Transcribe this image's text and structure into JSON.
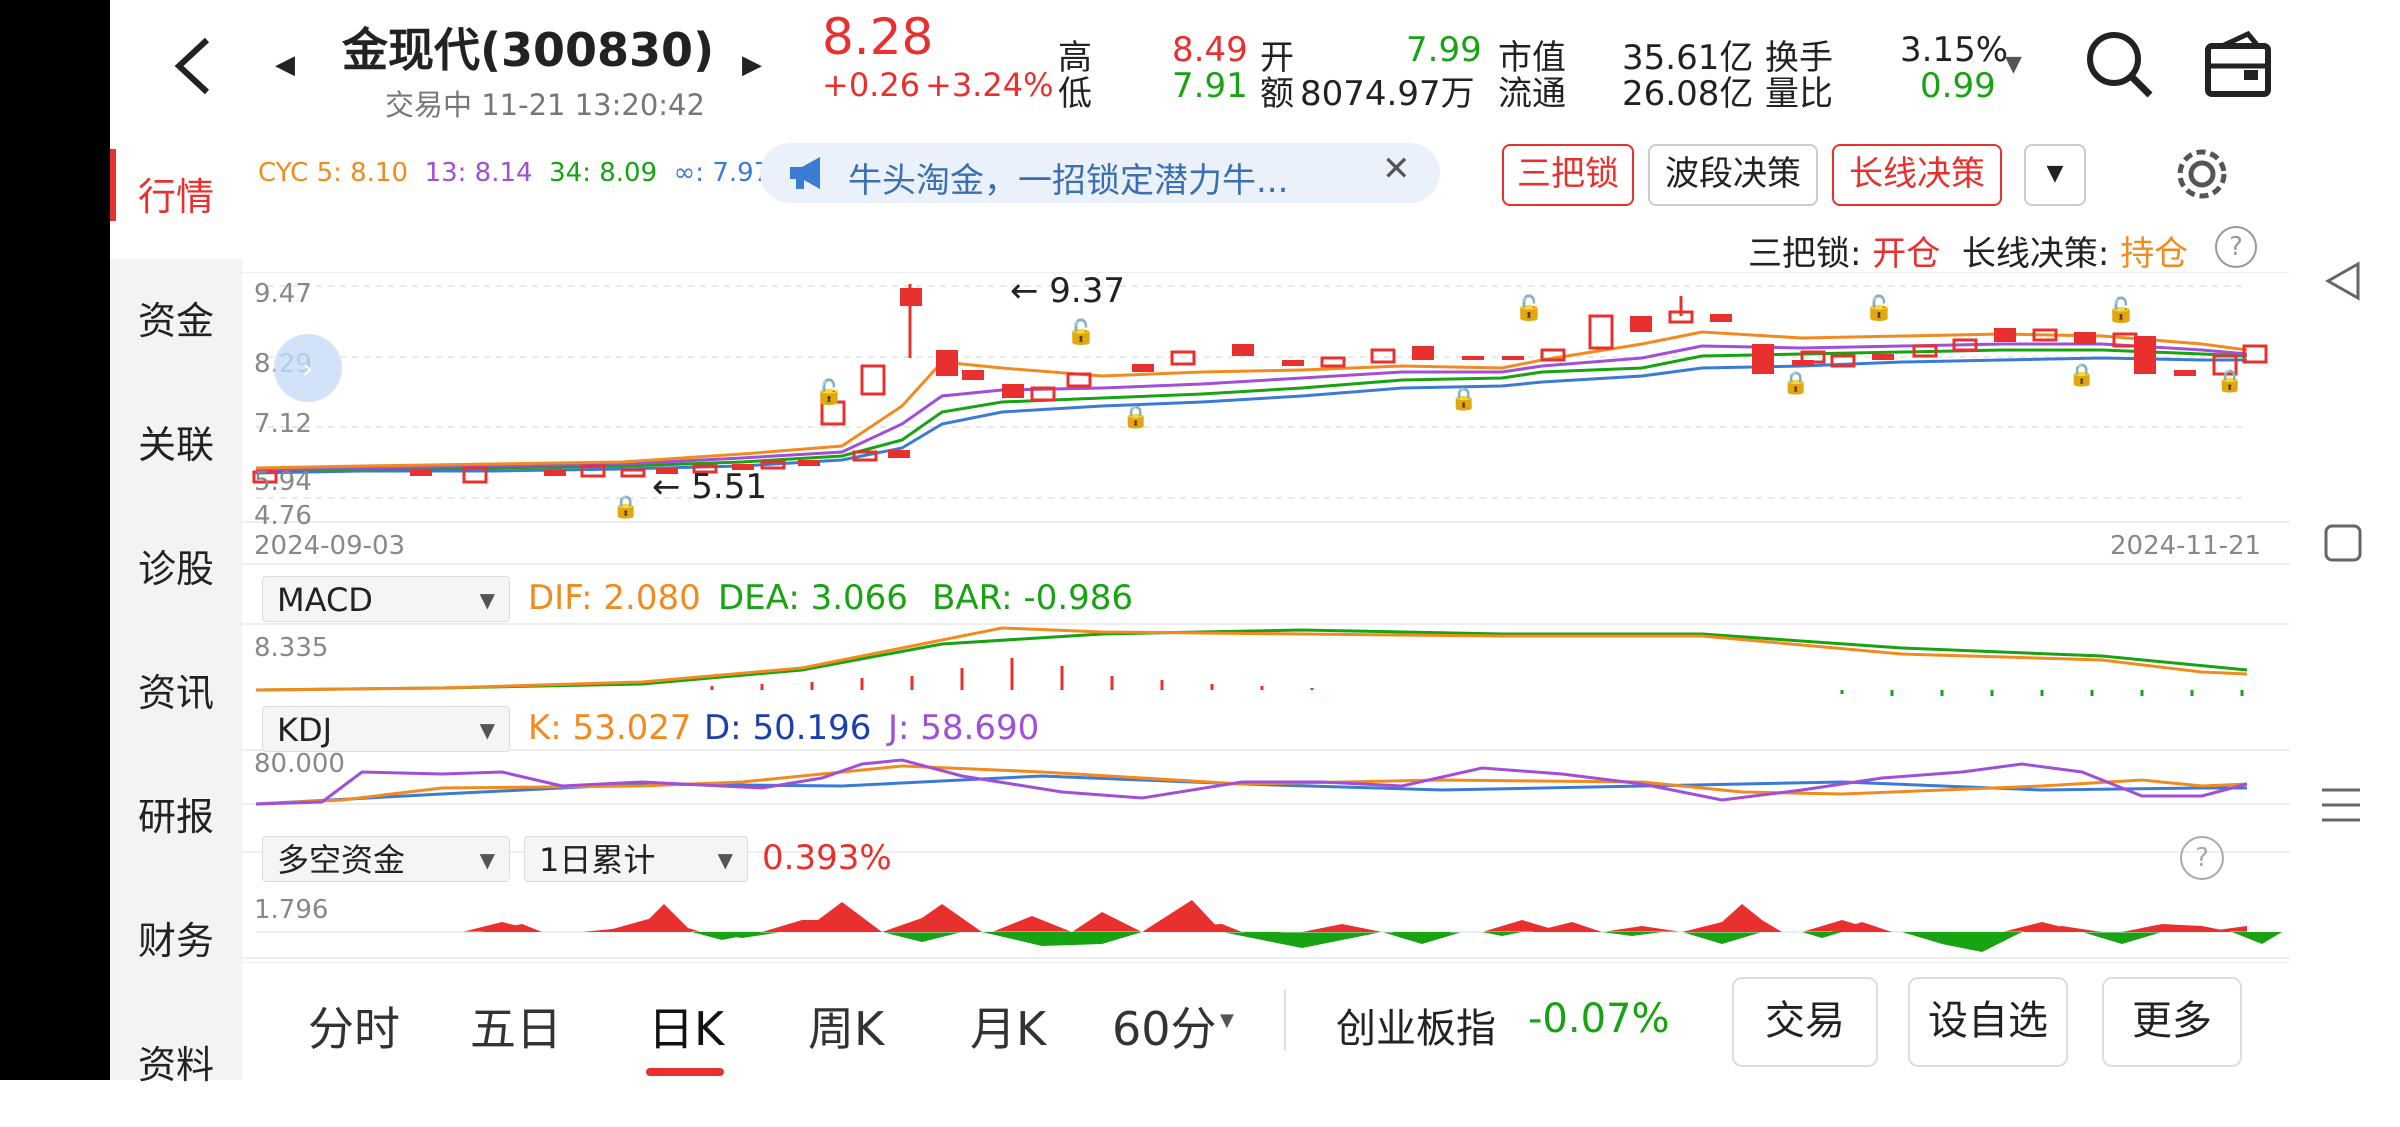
{
  "stock": {
    "name": "金现代(300830)",
    "status": "交易中 11-21 13:20:42",
    "price": "8.28",
    "change": "+0.26",
    "change_pct": "+3.24%",
    "high_label": "高",
    "high": "8.49",
    "low_label": "低",
    "low": "7.91",
    "open_label": "开",
    "open": "7.99",
    "amount_label": "额",
    "amount": "8074.97万",
    "mcap_label": "市值",
    "mcap": "35.61亿",
    "float_label": "流通",
    "float": "26.08亿",
    "turnover_label": "换手",
    "turnover": "3.15%",
    "volratio_label": "量比",
    "volratio": "0.99"
  },
  "sidebar": {
    "items": [
      {
        "label": "行情"
      },
      {
        "label": "资金"
      },
      {
        "label": "关联"
      },
      {
        "label": "诊股"
      },
      {
        "label": "资讯"
      },
      {
        "label": "研报"
      },
      {
        "label": "财务"
      },
      {
        "label": "资料"
      }
    ]
  },
  "cyc": {
    "prefix": "CYC 5: 8.10",
    "v13": "13: 8.14",
    "v34": "34: 8.09",
    "vinf": "∞: 7.97"
  },
  "promo": {
    "text": "牛头淘金，一招锁定潜力牛..."
  },
  "chips": {
    "sanba": "三把锁",
    "boduan": "波段决策",
    "changxian": "长线决策"
  },
  "signal": {
    "sanba_label": "三把锁:",
    "sanba_value": "开仓",
    "changxian_label": "长线决策:",
    "changxian_value": "持仓",
    "help": "?"
  },
  "kline": {
    "y_top": "9.47",
    "y_mid1": "8.29",
    "y_mid2": "7.12",
    "y_mid3": "5.94",
    "y_bottom": "4.76",
    "max_label": "← 9.37",
    "min_label": "← 5.51",
    "date_start": "2024-09-03",
    "date_end": "2024-11-21"
  },
  "macd": {
    "selector": "MACD",
    "dif": "DIF: 2.080",
    "dea": "DEA: 3.066",
    "bar": "BAR: -0.986",
    "y_top": "8.335"
  },
  "kdj": {
    "selector": "KDJ",
    "k": "K: 53.027",
    "d": "D: 50.196",
    "j": "J: 58.690",
    "y_top": "80.000"
  },
  "fund": {
    "selector": "多空资金",
    "period": "1日累计",
    "value": "0.393%",
    "y_top": "1.796",
    "help": "?"
  },
  "bottom": {
    "tabs": [
      "分时",
      "五日",
      "日K",
      "周K",
      "月K",
      "60分"
    ],
    "index_name": "创业板指",
    "index_change": "-0.07%",
    "trade": "交易",
    "watch": "设自选",
    "more": "更多"
  },
  "colors": {
    "up": "#e8312f",
    "down": "#17a312",
    "ma5": "#f28b1f",
    "ma13": "#a14fd6",
    "ma34": "#17a312",
    "mainf": "#3a7bd5"
  }
}
